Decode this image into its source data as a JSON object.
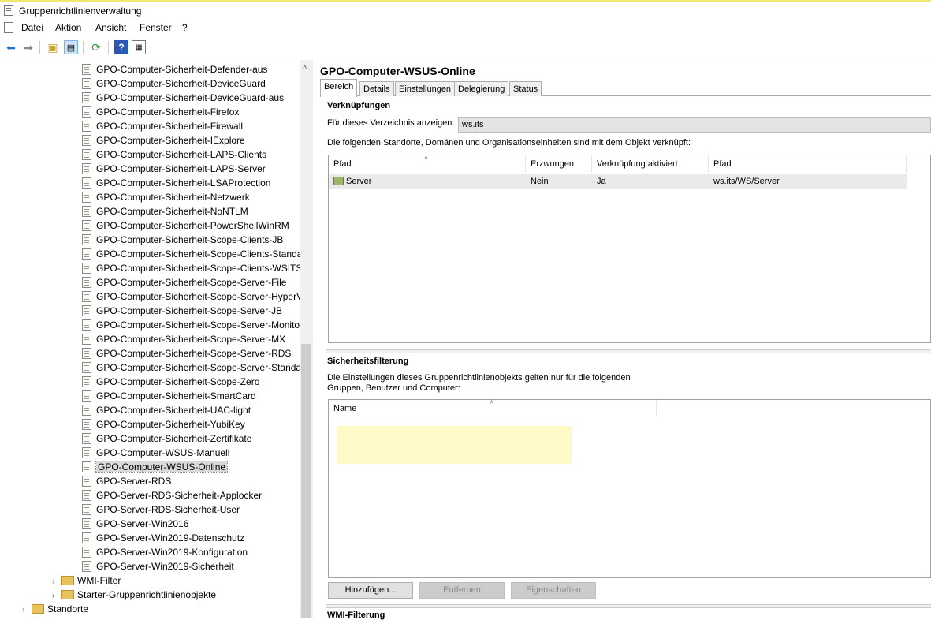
{
  "window": {
    "title": "Gruppenrichtlinienverwaltung"
  },
  "menu": [
    "Datei",
    "Aktion",
    "Ansicht",
    "Fenster",
    "?"
  ],
  "toolbar": {
    "icons": [
      "back-arrow-icon",
      "forward-arrow-icon",
      "up-folder-icon",
      "show-hide-tree-icon",
      "refresh-icon",
      "help-icon",
      "properties-icon"
    ]
  },
  "tree": {
    "gpos": [
      "GPO-Computer-Sicherheit-Defender-aus",
      "GPO-Computer-Sicherheit-DeviceGuard",
      "GPO-Computer-Sicherheit-DeviceGuard-aus",
      "GPO-Computer-Sicherheit-Firefox",
      "GPO-Computer-Sicherheit-Firewall",
      "GPO-Computer-Sicherheit-IExplore",
      "GPO-Computer-Sicherheit-LAPS-Clients",
      "GPO-Computer-Sicherheit-LAPS-Server",
      "GPO-Computer-Sicherheit-LSAProtection",
      "GPO-Computer-Sicherheit-Netzwerk",
      "GPO-Computer-Sicherheit-NoNTLM",
      "GPO-Computer-Sicherheit-PowerShellWinRM",
      "GPO-Computer-Sicherheit-Scope-Clients-JB",
      "GPO-Computer-Sicherheit-Scope-Clients-Standa",
      "GPO-Computer-Sicherheit-Scope-Clients-WSITS",
      "GPO-Computer-Sicherheit-Scope-Server-File",
      "GPO-Computer-Sicherheit-Scope-Server-HyperV",
      "GPO-Computer-Sicherheit-Scope-Server-JB",
      "GPO-Computer-Sicherheit-Scope-Server-Monito",
      "GPO-Computer-Sicherheit-Scope-Server-MX",
      "GPO-Computer-Sicherheit-Scope-Server-RDS",
      "GPO-Computer-Sicherheit-Scope-Server-Standa",
      "GPO-Computer-Sicherheit-Scope-Zero",
      "GPO-Computer-Sicherheit-SmartCard",
      "GPO-Computer-Sicherheit-UAC-light",
      "GPO-Computer-Sicherheit-YubiKey",
      "GPO-Computer-Sicherheit-Zertifikate",
      "GPO-Computer-WSUS-Manuell",
      "GPO-Computer-WSUS-Online",
      "GPO-Server-RDS",
      "GPO-Server-RDS-Sicherheit-Applocker",
      "GPO-Server-RDS-Sicherheit-User",
      "GPO-Server-Win2016",
      "GPO-Server-Win2019-Datenschutz",
      "GPO-Server-Win2019-Konfiguration",
      "GPO-Server-Win2019-Sicherheit"
    ],
    "selected": "GPO-Computer-WSUS-Online",
    "wmi": "WMI-Filter",
    "starter": "Starter-Gruppenrichtlinienobjekte",
    "sites": "Standorte"
  },
  "detail": {
    "title": "GPO-Computer-WSUS-Online",
    "tabs": [
      "Bereich",
      "Details",
      "Einstellungen",
      "Delegierung",
      "Status"
    ],
    "links": {
      "heading": "Verknüpfungen",
      "show_label": "Für dieses Verzeichnis anzeigen:",
      "show_value": "ws.its",
      "description": "Die folgenden Standorte, Domänen und Organisationseinheiten sind mit dem Objekt verknüpft:",
      "columns": [
        "Pfad",
        "Erzwungen",
        "Verknüpfung aktiviert",
        "Pfad"
      ],
      "rows": [
        {
          "name": "Server",
          "enforced": "Nein",
          "enabled": "Ja",
          "path": "ws.its/WS/Server"
        }
      ]
    },
    "security": {
      "heading": "Sicherheitsfilterung",
      "desc1": "Die Einstellungen dieses Gruppenrichtlinienobjekts gelten nur für die folgenden",
      "desc2": "Gruppen, Benutzer und Computer:",
      "column": "Name",
      "buttons": [
        "Hinzufügen...",
        "Entfernen",
        "Eigenschaften"
      ]
    },
    "wmi_heading": "WMI-Filterung"
  }
}
